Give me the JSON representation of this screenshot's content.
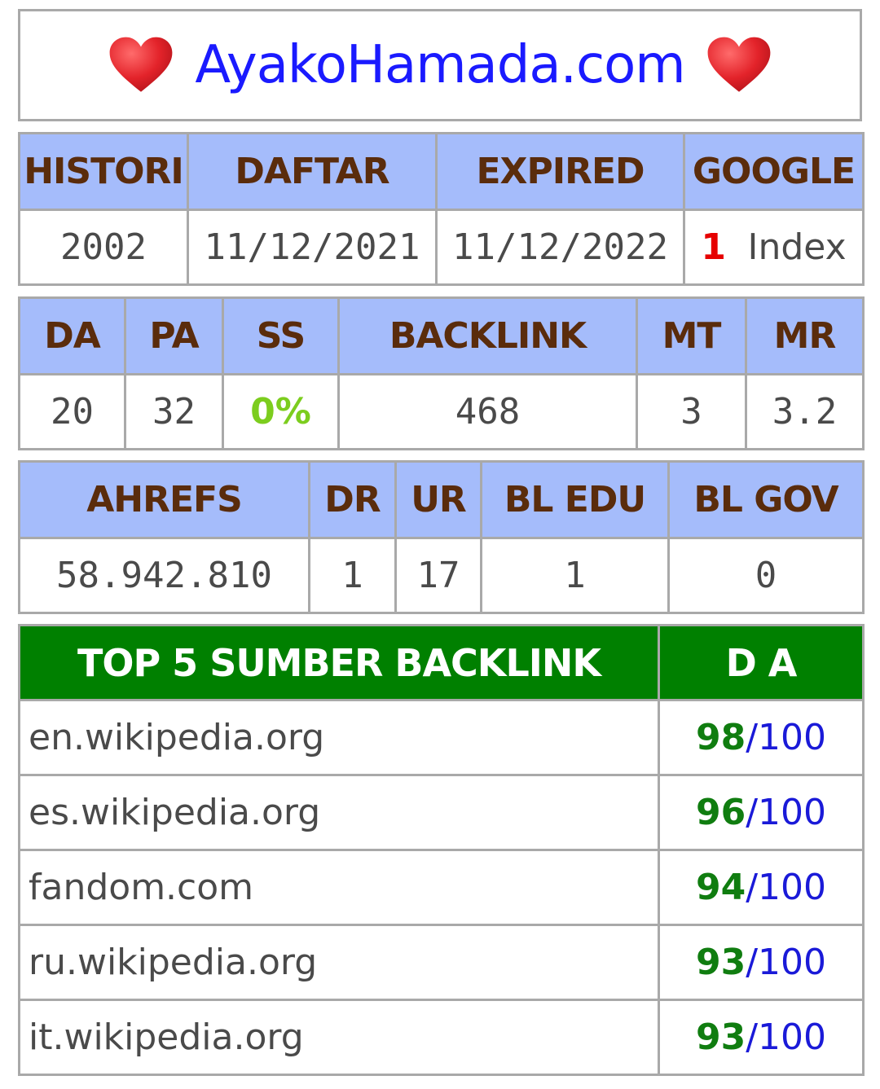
{
  "site": {
    "title": "AyakoHamada.com",
    "accent_color": "#1a1aff",
    "icon": "heart-icon"
  },
  "domain_info": {
    "headers": [
      "HISTORI",
      "DAFTAR",
      "EXPIRED",
      "GOOGLE"
    ],
    "histori": "2002",
    "daftar": "11/12/2021",
    "expired": "11/12/2022",
    "google_index_count": "1",
    "google_index_label": "Index"
  },
  "moz": {
    "headers": [
      "DA",
      "PA",
      "SS",
      "BACKLINK",
      "MT",
      "MR"
    ],
    "da": "20",
    "pa": "32",
    "ss": "0%",
    "backlink": "468",
    "mt": "3",
    "mr": "3.2"
  },
  "ahrefs": {
    "headers": [
      "AHREFS",
      "DR",
      "UR",
      "BL EDU",
      "BL GOV"
    ],
    "ahrefs": "58.942.810",
    "dr": "1",
    "ur": "17",
    "bl_edu": "1",
    "bl_gov": "0"
  },
  "top_backlinks": {
    "header_source": "TOP 5 SUMBER BACKLINK",
    "header_da": "D A",
    "separator": "/",
    "max": "100",
    "rows": [
      {
        "site": "en.wikipedia.org",
        "da": "98"
      },
      {
        "site": "es.wikipedia.org",
        "da": "96"
      },
      {
        "site": "fandom.com",
        "da": "94"
      },
      {
        "site": "ru.wikipedia.org",
        "da": "93"
      },
      {
        "site": "it.wikipedia.org",
        "da": "93"
      }
    ]
  },
  "colors": {
    "header_bg": "#a5bcfb",
    "header_text": "#5a2c0c",
    "green_header": "#008000",
    "ss_green": "#7ccd1e",
    "index_red": "#e60000",
    "border": "#a9a9a9"
  }
}
